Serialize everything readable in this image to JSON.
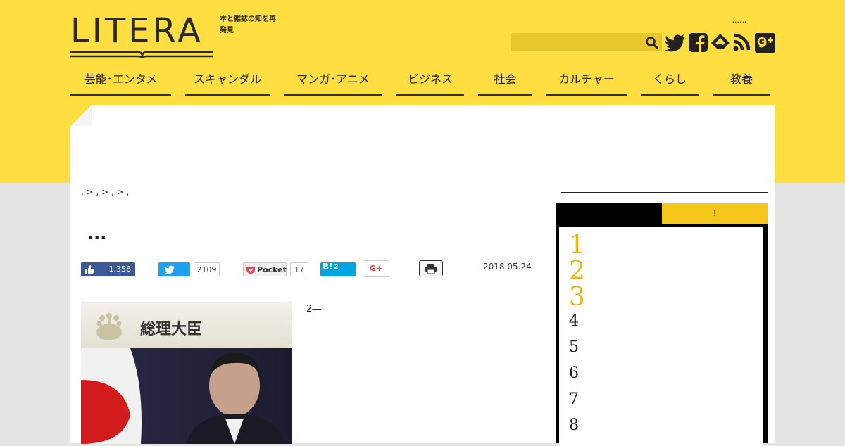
{
  "header": {
    "logo_text": "LITERA",
    "tagline": "本と雑誌の知を再発見",
    "top_links_text": "......",
    "search": {
      "placeholder": "",
      "value": ""
    }
  },
  "social_icons": [
    "twitter-icon",
    "facebook-icon",
    "feedly-icon",
    "rss-icon",
    "google-plus-icon"
  ],
  "nav": [
    {
      "label": "芸能･エンタメ"
    },
    {
      "label": "スキャンダル"
    },
    {
      "label": "マンガ･アニメ"
    },
    {
      "label": "ビジネス"
    },
    {
      "label": "社会"
    },
    {
      "label": "カルチャー"
    },
    {
      "label": "くらし"
    },
    {
      "label": "教養"
    }
  ],
  "article": {
    "breadcrumb": ", > , > , > ,",
    "title": "...",
    "date": "2018.05.24",
    "body_first_line": "2―"
  },
  "share": {
    "facebook_count": "1,356",
    "twitter_count": "2109",
    "pocket_label": "Pocket",
    "pocket_count": "17",
    "hatena_label": "B!",
    "hatena_count": "2",
    "gplus_label": "G+"
  },
  "photo": {
    "caption_heading": "総理大臣"
  },
  "sidebar": {
    "tab_left": "",
    "tab_right": "!",
    "ranks": [
      "1",
      "2",
      "3",
      "4",
      "5",
      "6",
      "7",
      "8"
    ]
  },
  "colors": {
    "brand_yellow": "#ffde42",
    "rank_gold": "#e9b90f",
    "facebook_blue": "#3b5998",
    "twitter_blue": "#1da1f2",
    "hatena_blue": "#00a4de"
  }
}
